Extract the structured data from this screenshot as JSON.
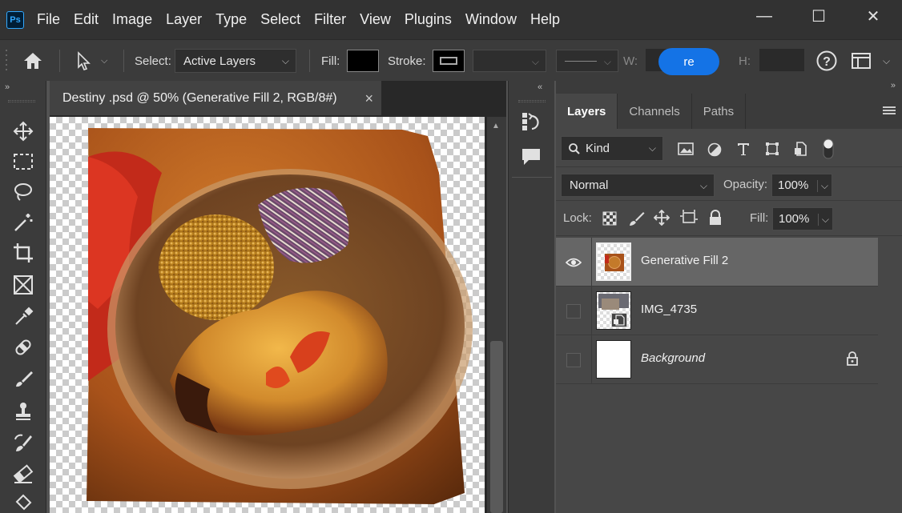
{
  "app": {
    "logo": "Ps"
  },
  "menu": [
    "File",
    "Edit",
    "Image",
    "Layer",
    "Type",
    "Select",
    "Filter",
    "View",
    "Plugins",
    "Window",
    "Help"
  ],
  "window_controls": {
    "minimize": "—",
    "maximize": "☐",
    "close": "✕"
  },
  "options": {
    "select_label": "Select:",
    "select_value": "Active Layers",
    "fill_label": "Fill:",
    "stroke_label": "Stroke:",
    "w_label": "W:",
    "h_label": "H:",
    "w_fragment": "re",
    "fill_color": "#000000",
    "stroke_color": "#000000"
  },
  "document": {
    "tab_title": "Destiny .psd @ 50% (Generative Fill 2, RGB/8#)",
    "tab_close": "×"
  },
  "panel": {
    "tabs": [
      "Layers",
      "Channels",
      "Paths"
    ],
    "filter_label": "Kind",
    "blend_mode": "Normal",
    "opacity_label": "Opacity:",
    "opacity_value": "100%",
    "lock_label": "Lock:",
    "fill_label": "Fill:",
    "fill_value": "100%",
    "layers": [
      {
        "name": "Generative Fill 2",
        "visible": true,
        "selected": true
      },
      {
        "name": "IMG_4735",
        "visible": false,
        "selected": false
      },
      {
        "name": "Background",
        "visible": false,
        "selected": false,
        "locked": true
      }
    ]
  },
  "colors": {
    "accent": "#1473e6",
    "chrome_dark": "#323232",
    "panel": "#474747"
  }
}
